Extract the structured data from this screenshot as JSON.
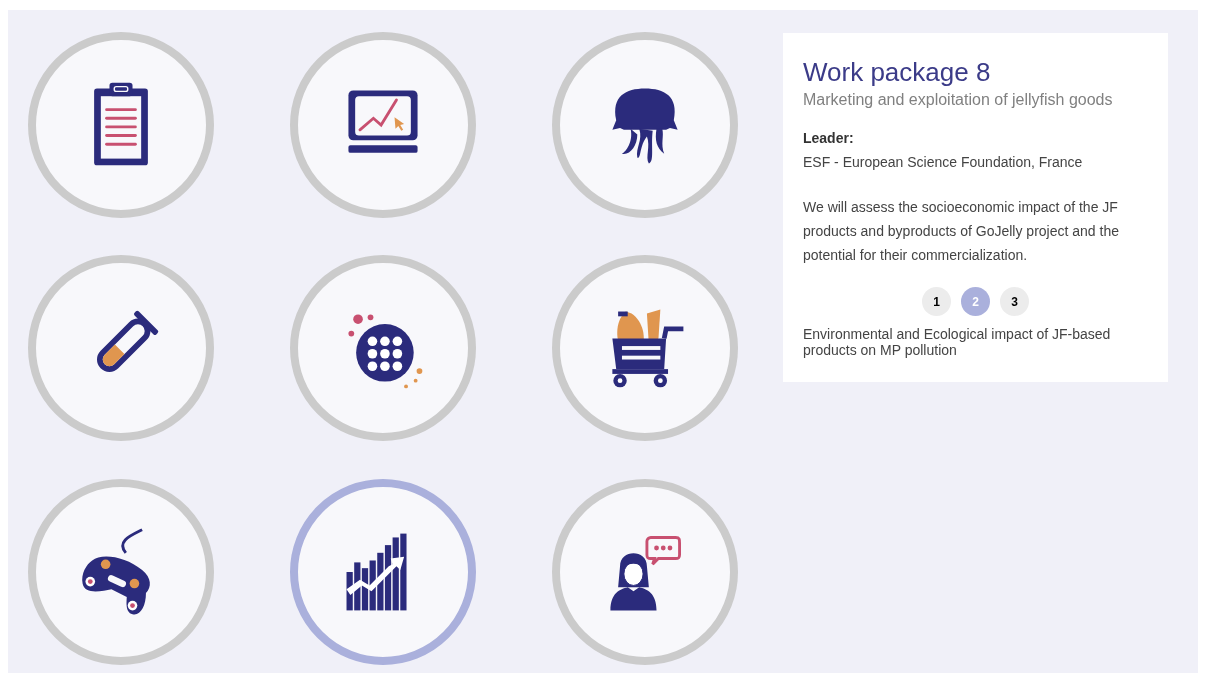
{
  "work_packages": [
    {
      "kind": "clipboard",
      "selected": false
    },
    {
      "kind": "laptop_chart",
      "selected": false
    },
    {
      "kind": "jellyfish",
      "selected": false
    },
    {
      "kind": "test_tube",
      "selected": false
    },
    {
      "kind": "petri_dish",
      "selected": false
    },
    {
      "kind": "cart",
      "selected": false
    },
    {
      "kind": "controller",
      "selected": false
    },
    {
      "kind": "growth_chart",
      "selected": true
    },
    {
      "kind": "person_speech",
      "selected": false
    }
  ],
  "card": {
    "title": "Work package 8",
    "subtitle": "Marketing and exploitation of jellyfish goods",
    "leader_label": "Leader:",
    "leader": "ESF - European Science Foundation, France",
    "description": "We will assess the socioeconomic impact of the JF products and byproducts of GoJelly project and the potential for their commercialization.",
    "pages": [
      {
        "label": "1",
        "selected": false
      },
      {
        "label": "2",
        "selected": true
      },
      {
        "label": "3",
        "selected": false
      }
    ],
    "caption": "Environmental and Ecological impact of JF-based products on MP pollution"
  }
}
